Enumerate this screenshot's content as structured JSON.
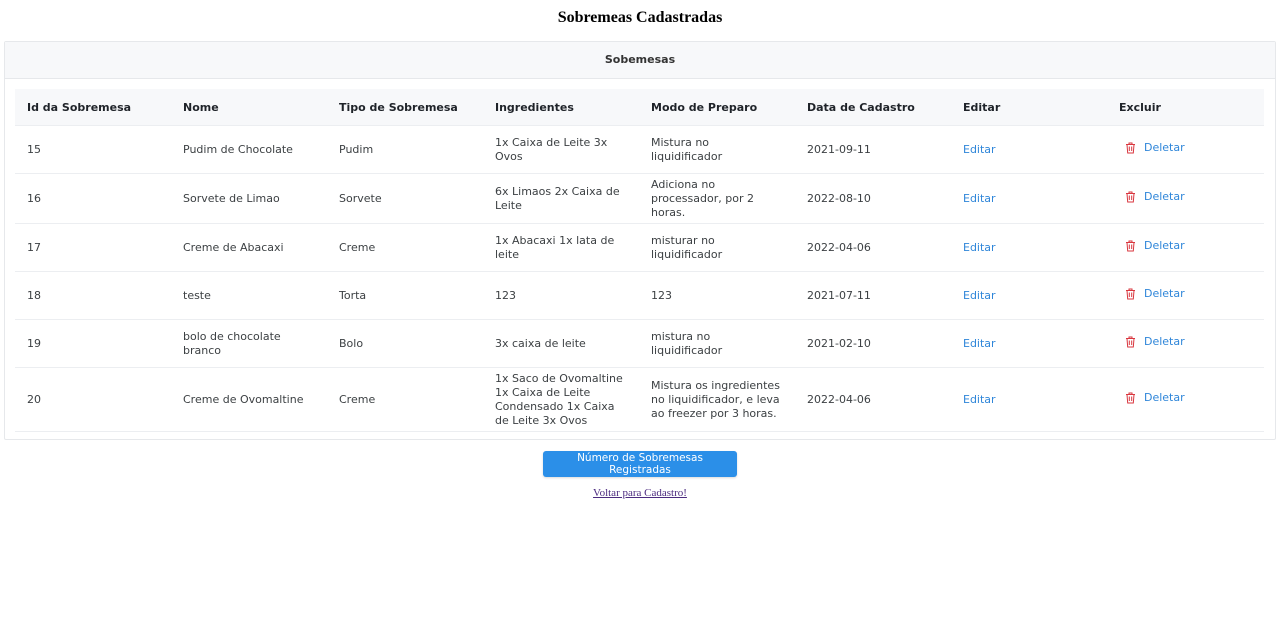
{
  "page": {
    "title": "Sobremeas Cadastradas"
  },
  "card": {
    "header": "Sobemesas"
  },
  "table": {
    "columns": [
      "Id da Sobremesa",
      "Nome",
      "Tipo de Sobremesa",
      "Ingredientes",
      "Modo de Preparo",
      "Data de Cadastro",
      "Editar",
      "Excluir"
    ],
    "rows": [
      {
        "id": "15",
        "nome": "Pudim de Chocolate",
        "tipo": "Pudim",
        "ingredientes": "1x Caixa de Leite 3x Ovos",
        "preparo": "Mistura no liquidificador",
        "data": "2021-09-11",
        "editar": "Editar",
        "excluir": "Deletar"
      },
      {
        "id": "16",
        "nome": "Sorvete de Limao",
        "tipo": "Sorvete",
        "ingredientes": "6x Limaos 2x Caixa de Leite",
        "preparo": "Adiciona no processador, por 2 horas.",
        "data": "2022-08-10",
        "editar": "Editar",
        "excluir": "Deletar"
      },
      {
        "id": "17",
        "nome": "Creme de Abacaxi",
        "tipo": "Creme",
        "ingredientes": "1x Abacaxi 1x lata de leite",
        "preparo": "misturar no liquidificador",
        "data": "2022-04-06",
        "editar": "Editar",
        "excluir": "Deletar"
      },
      {
        "id": "18",
        "nome": "teste",
        "tipo": "Torta",
        "ingredientes": "123",
        "preparo": "123",
        "data": "2021-07-11",
        "editar": "Editar",
        "excluir": "Deletar"
      },
      {
        "id": "19",
        "nome": "bolo de chocolate branco",
        "tipo": "Bolo",
        "ingredientes": "3x caixa de leite",
        "preparo": "mistura no liquidificador",
        "data": "2021-02-10",
        "editar": "Editar",
        "excluir": "Deletar"
      },
      {
        "id": "20",
        "nome": "Creme de Ovomaltine",
        "tipo": "Creme",
        "ingredientes": "1x Saco de Ovomaltine 1x Caixa de Leite Condensado 1x Caixa de Leite 3x Ovos",
        "preparo": "Mistura os ingredientes no liquidificador, e leva ao freezer por 3 horas.",
        "data": "2022-04-06",
        "editar": "Editar",
        "excluir": "Deletar"
      }
    ]
  },
  "actions": {
    "count_button": "Número de Sobremesas Registradas",
    "back_link": "Voltar para Cadastro!"
  },
  "colors": {
    "link": "#2f86d9",
    "delete_icon": "#d9363e",
    "button": "#2b8fe8"
  },
  "icons": {
    "delete": "trash-icon"
  }
}
